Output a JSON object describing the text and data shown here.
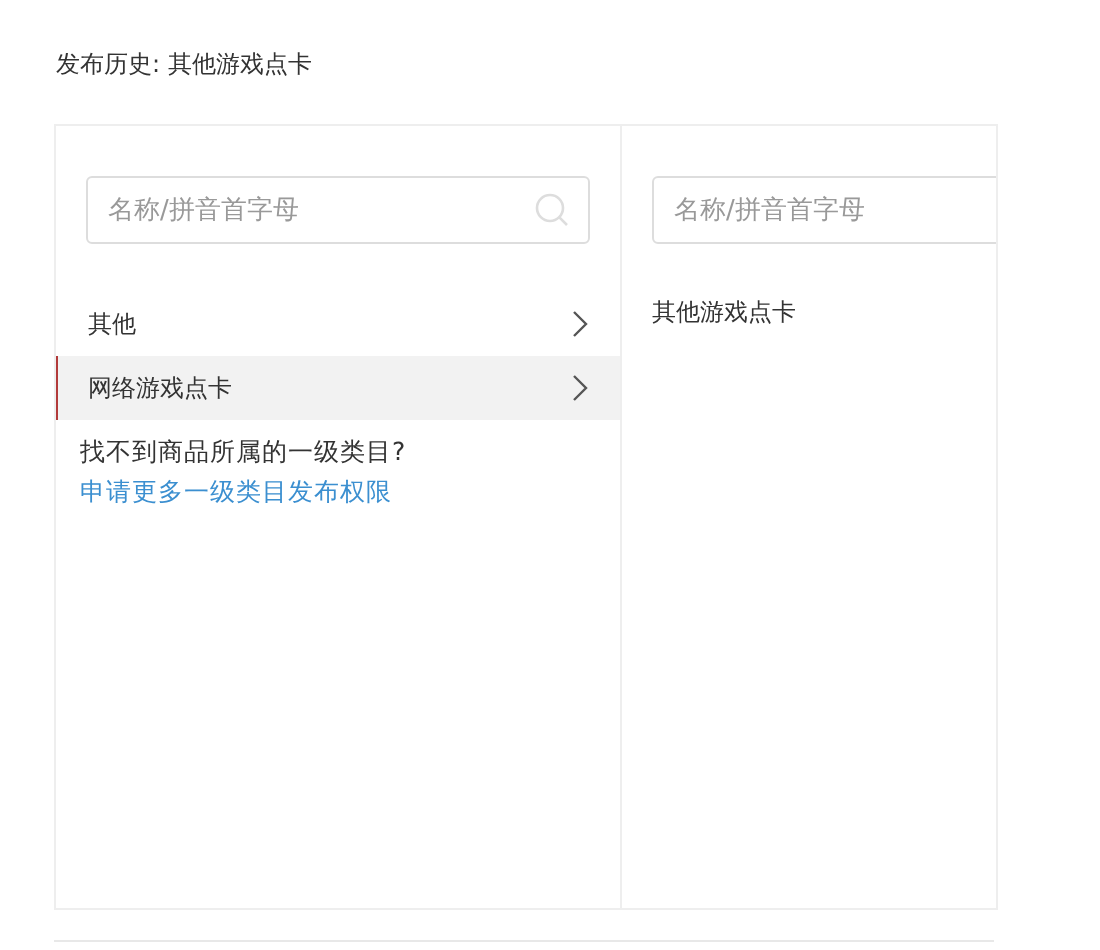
{
  "history": {
    "label": "发布历史:",
    "value": "其他游戏点卡"
  },
  "columns": [
    {
      "search": {
        "placeholder": "名称/拼音首字母"
      },
      "items": [
        {
          "label": "其他",
          "selected": false,
          "has_children": true
        },
        {
          "label": "网络游戏点卡",
          "selected": true,
          "has_children": true
        }
      ],
      "hint": {
        "text": "找不到商品所属的一级类目?",
        "link": "申请更多一级类目发布权限"
      }
    },
    {
      "search": {
        "placeholder": "名称/拼音首字母"
      },
      "items": [
        {
          "label": "其他游戏点卡",
          "selected": false,
          "has_children": false
        }
      ]
    }
  ]
}
